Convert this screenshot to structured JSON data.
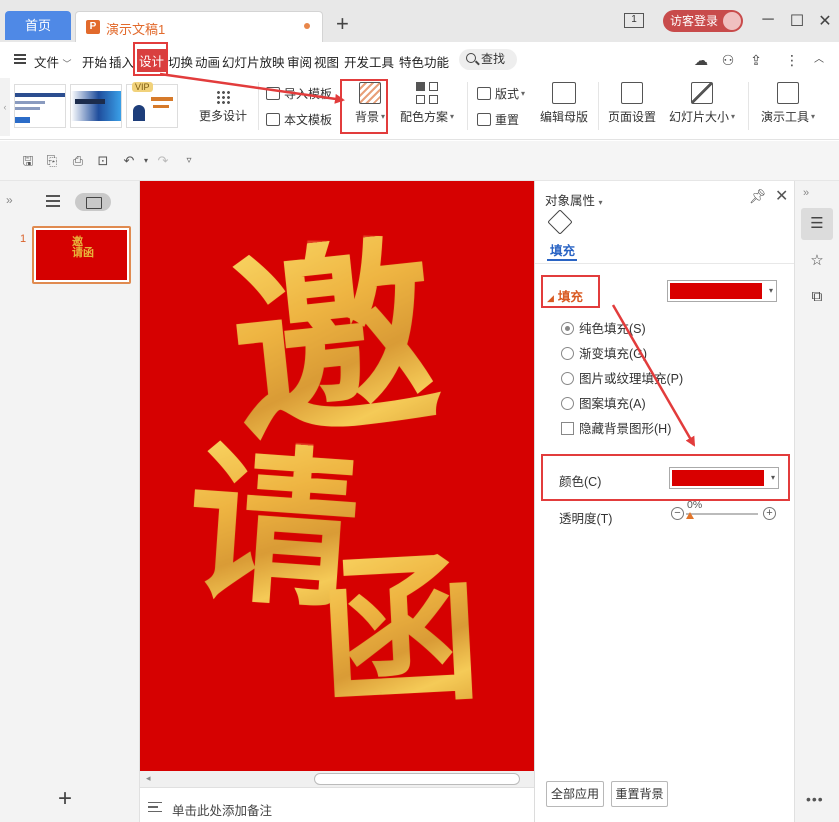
{
  "titlebar": {
    "home_tab": "首页",
    "doc_tab": "演示文稿1",
    "doc_icon": "P",
    "new_tab": "+",
    "window_count": "1",
    "login": "访客登录",
    "minimize": "─",
    "restore": "☐",
    "close": "✕"
  },
  "menu": {
    "file": "文件",
    "items": [
      "开始",
      "插入",
      "设计",
      "切换",
      "动画",
      "幻灯片放映",
      "审阅",
      "视图",
      "开发工具",
      "特色功能"
    ],
    "active": "设计",
    "search": "查找"
  },
  "ribbon": {
    "more_design": "更多设计",
    "vip": "VIP",
    "import_template": "导入模板",
    "this_template": "本文模板",
    "background": "背景",
    "color_scheme": "配色方案",
    "layout": "版式",
    "reset": "重置",
    "edit_master": "编辑母版",
    "page_setup": "页面设置",
    "slide_size": "幻灯片大小",
    "present_tools": "演示工具"
  },
  "left_panel": {
    "slide_number": "1",
    "add": "+"
  },
  "slide": {
    "char1": "邀",
    "char2": "请",
    "char3": "函"
  },
  "notes": {
    "placeholder": "单击此处添加备注"
  },
  "properties": {
    "title": "对象属性",
    "tab_fill": "填充",
    "section": "填充",
    "options": [
      "纯色填充(S)",
      "渐变填充(G)",
      "图片或纹理填充(P)",
      "图案填充(A)"
    ],
    "selected_option": "纯色填充(S)",
    "hide_bg": "隐藏背景图形(H)",
    "color_label": "颜色(C)",
    "transparency_label": "透明度(T)",
    "transparency_value": "0%",
    "apply_all": "全部应用",
    "reset_bg": "重置背景",
    "fill_color": "#d90000"
  },
  "colors": {
    "slide_bg": "#d60101",
    "accent_orange": "#e26a2c",
    "annotation_red": "#e23c3c",
    "home_tab_blue": "#4f89e6"
  }
}
